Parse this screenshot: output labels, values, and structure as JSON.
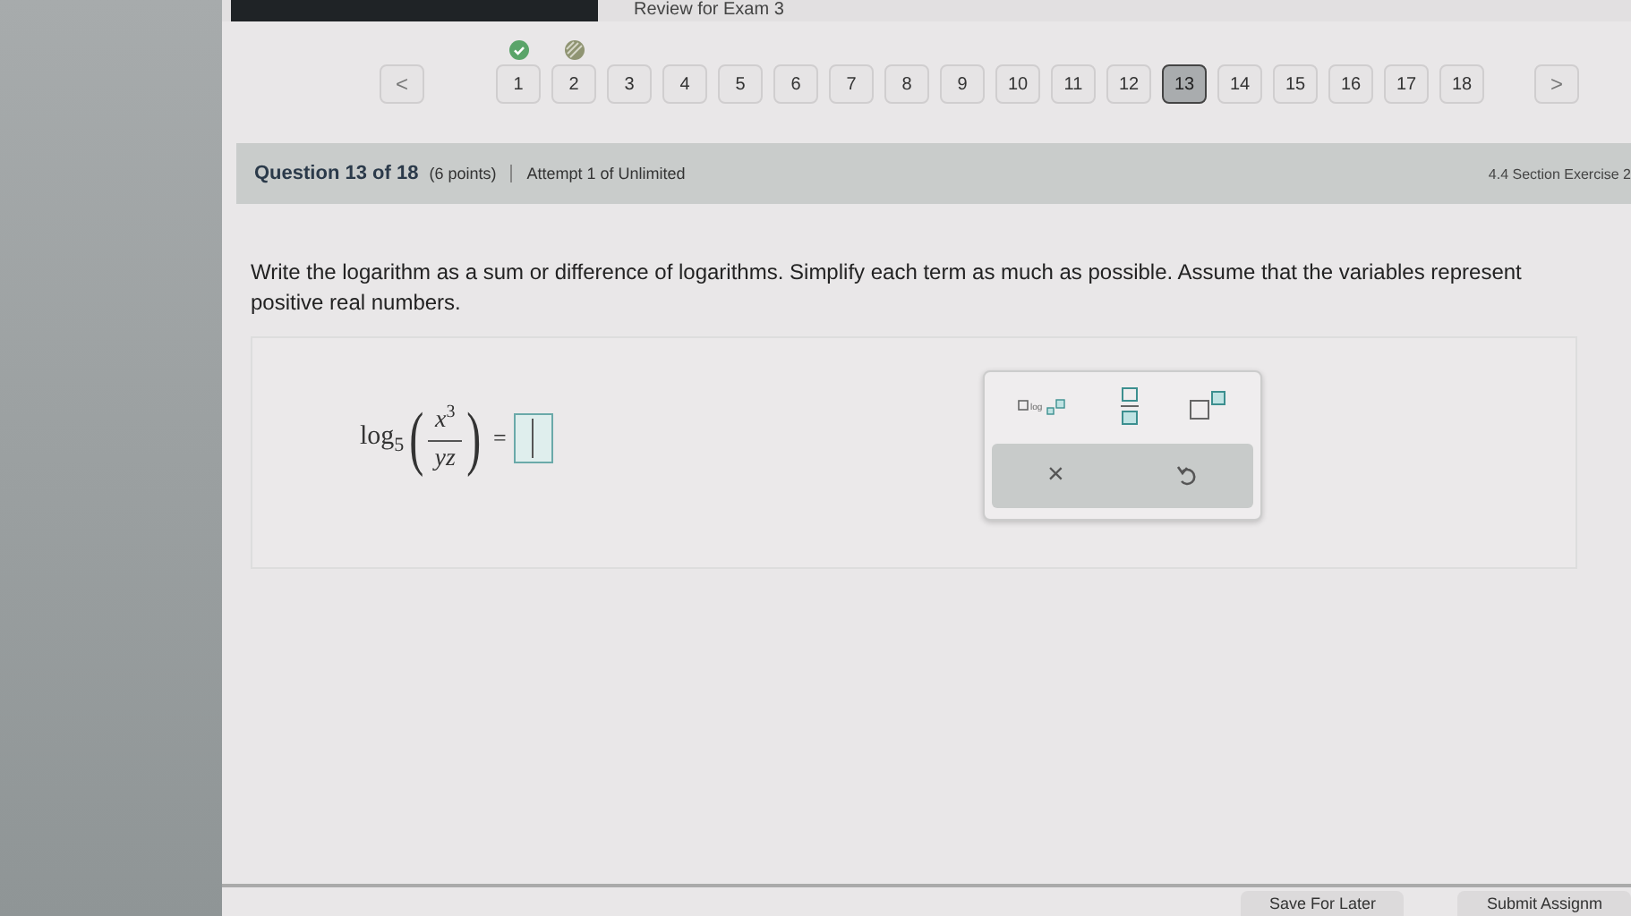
{
  "header": {
    "title": "Review for Exam 3"
  },
  "question_nav": {
    "prev": "<",
    "next": ">",
    "items": [
      {
        "label": "1",
        "selected": false,
        "kind": "correct"
      },
      {
        "label": "2",
        "selected": false,
        "kind": "partial"
      },
      {
        "label": "3",
        "selected": false,
        "kind": "plain"
      },
      {
        "label": "4",
        "selected": false,
        "kind": "plain"
      },
      {
        "label": "5",
        "selected": false,
        "kind": "plain"
      },
      {
        "label": "6",
        "selected": false,
        "kind": "plain"
      },
      {
        "label": "7",
        "selected": false,
        "kind": "plain"
      },
      {
        "label": "8",
        "selected": false,
        "kind": "plain"
      },
      {
        "label": "9",
        "selected": false,
        "kind": "plain"
      },
      {
        "label": "10",
        "selected": false,
        "kind": "plain"
      },
      {
        "label": "11",
        "selected": false,
        "kind": "plain"
      },
      {
        "label": "12",
        "selected": false,
        "kind": "plain"
      },
      {
        "label": "13",
        "selected": true,
        "kind": "plain"
      },
      {
        "label": "14",
        "selected": false,
        "kind": "plain"
      },
      {
        "label": "15",
        "selected": false,
        "kind": "plain"
      },
      {
        "label": "16",
        "selected": false,
        "kind": "plain"
      },
      {
        "label": "17",
        "selected": false,
        "kind": "plain"
      },
      {
        "label": "18",
        "selected": false,
        "kind": "plain"
      }
    ]
  },
  "question_bar": {
    "title": "Question 13 of 18",
    "points": "(6 points)",
    "attempt": "Attempt 1 of Unlimited",
    "section": "4.4 Section Exercise 2"
  },
  "instructions": "Write the logarithm as a sum or difference of logarithms. Simplify each term as much as possible. Assume that the variables represent positive real numbers.",
  "expression": {
    "func": "log",
    "base": "5",
    "open": "(",
    "close": ")",
    "numerator": "x",
    "exponent": "3",
    "denominator": "yz",
    "equals": "="
  },
  "palette": {
    "templates": [
      {
        "kind": "log"
      },
      {
        "kind": "fraction"
      },
      {
        "kind": "power"
      }
    ],
    "actions": [
      {
        "kind": "clear",
        "symbol": "×"
      },
      {
        "kind": "undo"
      }
    ]
  },
  "footer": {
    "buttons": [
      "Save For Later",
      "Submit Assignm"
    ]
  }
}
